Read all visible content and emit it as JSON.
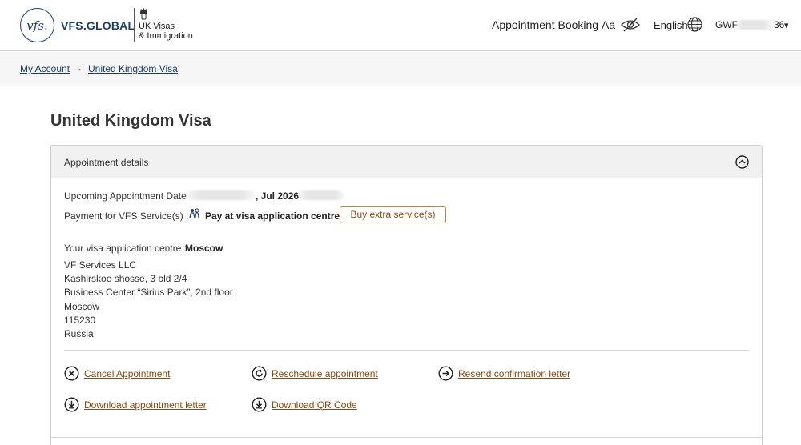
{
  "header": {
    "logo_mark": "vfs.",
    "brand": "VFS.GLOBAL",
    "ukvi_line1": "UK Visas",
    "ukvi_line2": "& Immigration",
    "nav_appointment": "Appointment Booking",
    "text_size": "Aa",
    "language": "English",
    "account_prefix": "GWF",
    "account_suffix": "36",
    "account_caret": "▾"
  },
  "breadcrumb": {
    "my_account": "My Account",
    "arrow": "→",
    "current": "United Kingdom Visa"
  },
  "page_title": "United Kingdom Visa",
  "panel": {
    "title": "Appointment details",
    "date_label": "Upcoming Appointment Date",
    "date_value": ", Jul 2026",
    "payment_label": "Payment for VFS Service(s) :",
    "payment_value": "Pay at visa application centre",
    "buy_button": "Buy extra service(s)",
    "centre_label": "Your visa application centre :",
    "centre_value": "Moscow",
    "address": [
      "VF Services LLC",
      "Kashirskoe shosse, 3 bld 2/4",
      "Business Center “Sirius Park”, 2nd floor",
      "Moscow",
      "115230",
      "Russia"
    ],
    "actions": {
      "cancel": "Cancel Appointment",
      "reschedule": "Reschedule appointment",
      "resend": "Resend confirmation letter",
      "download_letter": "Download appointment letter",
      "download_qr": "Download QR Code"
    }
  },
  "colors": {
    "brand_navy": "#1c3e6b",
    "action_brown": "#8a4a10",
    "button_border": "#b8864d"
  }
}
